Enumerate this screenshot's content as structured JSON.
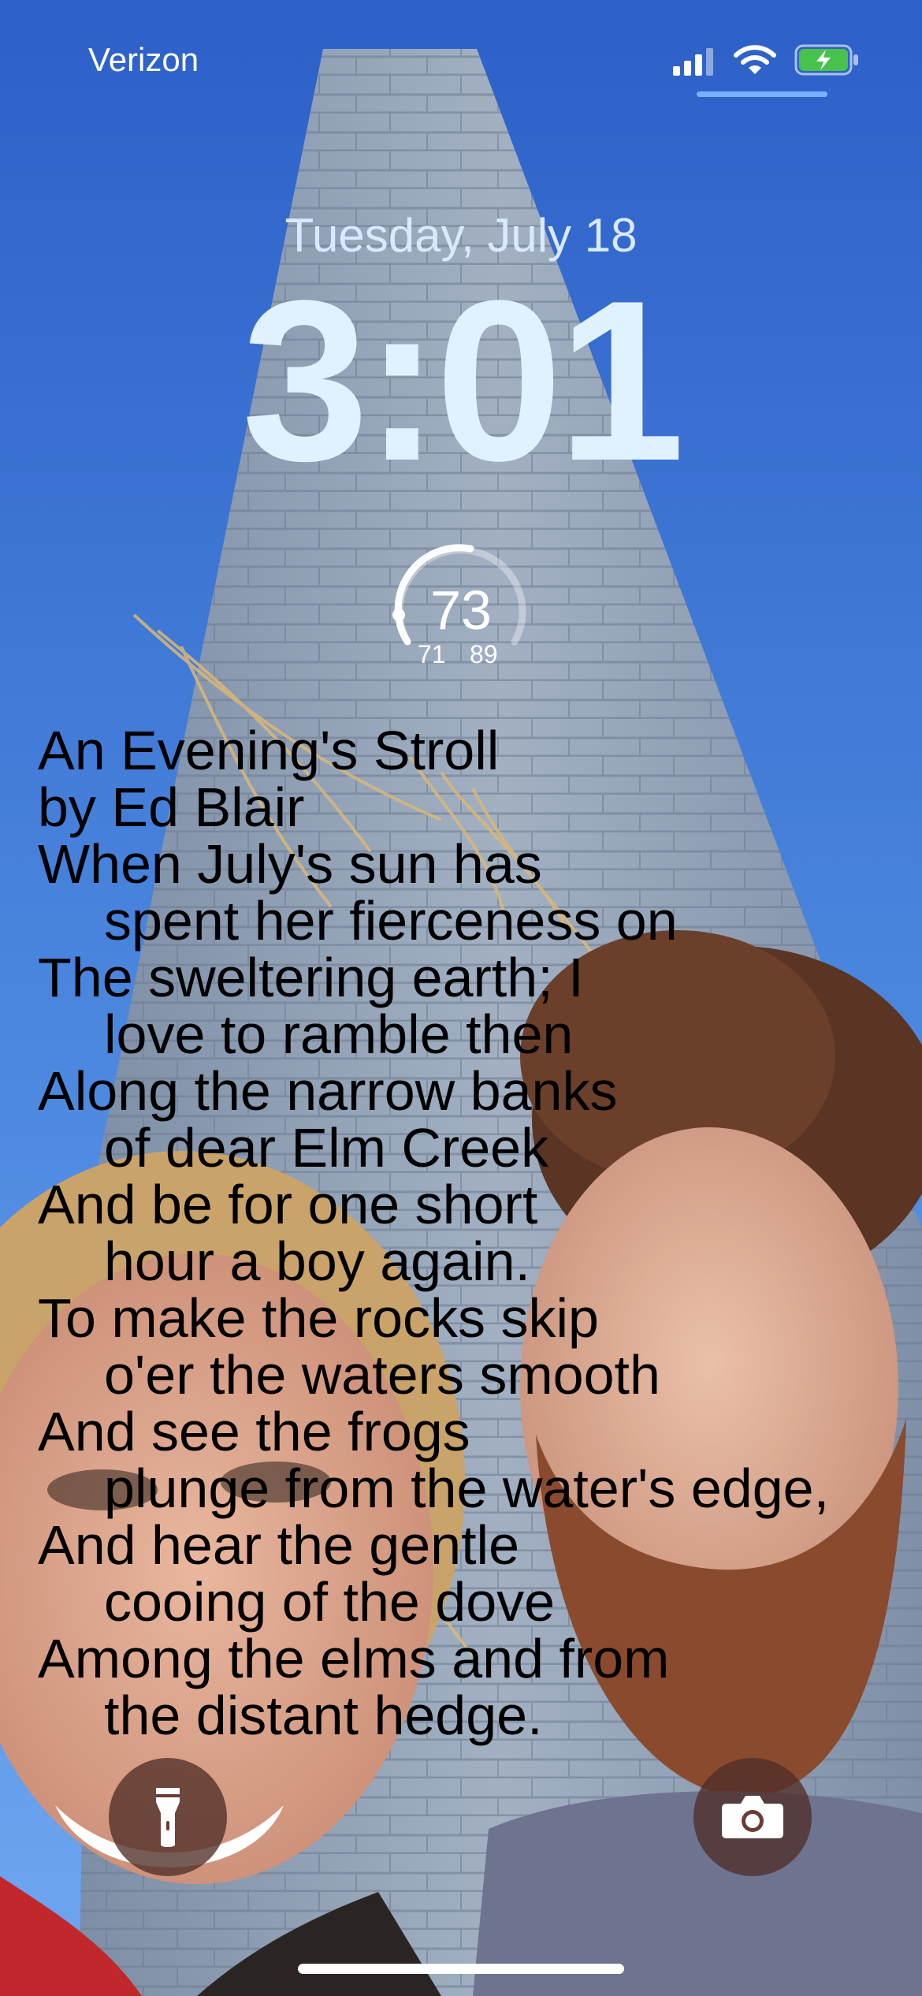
{
  "status_bar": {
    "carrier": "Verizon",
    "signal_icon": "cellular-signal-icon",
    "wifi_icon": "wifi-icon",
    "battery_icon": "battery-charging-icon"
  },
  "lock_screen": {
    "date": "Tuesday, July 18",
    "time": "3:01"
  },
  "weather_widget": {
    "current_temp": "73",
    "low_temp": "71",
    "high_temp": "89"
  },
  "poem": {
    "lines": [
      "An Evening's Stroll",
      "by Ed Blair",
      "When July's sun has",
      "spent her fierceness on",
      "The sweltering earth; I",
      "love to ramble then",
      "Along the narrow banks",
      "of dear Elm Creek",
      "And be for one short",
      "hour a boy again.",
      "To make the rocks skip",
      "o'er the waters smooth",
      "And see the frogs",
      "plunge from the water's edge,",
      "And hear the gentle",
      "cooing of the dove",
      "Among the elms and from",
      "the distant hedge."
    ]
  },
  "quick_actions": {
    "left_icon": "flashlight-icon",
    "right_icon": "camera-icon"
  },
  "colors": {
    "sky_top": "#2f63c9",
    "sky_bottom": "#5a97e8",
    "clock": "#e0f2ff",
    "button_bg": "#502e28"
  }
}
